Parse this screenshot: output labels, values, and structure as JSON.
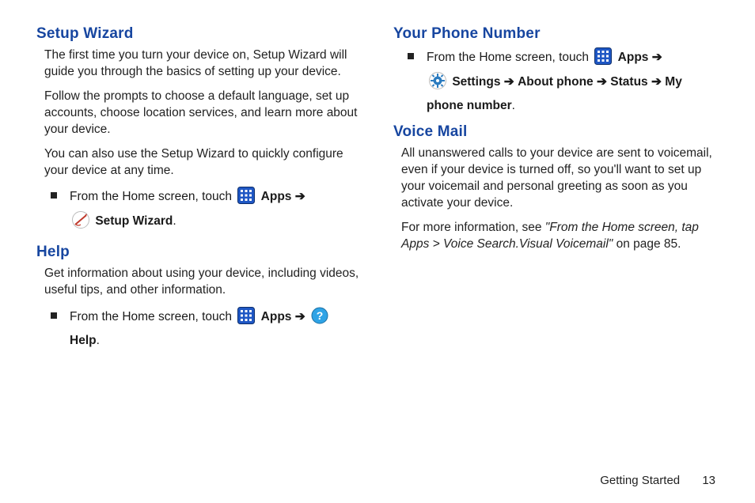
{
  "left": {
    "setup_wizard": {
      "heading": "Setup Wizard",
      "p1": "The first time you turn your device on, Setup Wizard will guide you through the basics of setting up your device.",
      "p2": "Follow the prompts to choose a default language, set up accounts, choose location services, and learn more about your device.",
      "p3": "You can also use the Setup Wizard to quickly configure your device at any time.",
      "step_prefix": "From the Home screen, touch ",
      "apps_label": "Apps",
      "arrow": "➔",
      "setup_wizard_label": "Setup Wizard"
    },
    "help": {
      "heading": "Help",
      "p1": "Get information about using your device, including videos, useful tips, and other information.",
      "step_prefix": "From the Home screen, touch ",
      "apps_label": "Apps",
      "arrow": "➔",
      "help_label": "Help"
    }
  },
  "right": {
    "phone_number": {
      "heading": "Your Phone Number",
      "step_prefix": "From the Home screen, touch ",
      "apps_label": "Apps",
      "arrow": "➔",
      "settings_label": "Settings",
      "about_label": "About phone",
      "status_label": "Status",
      "my_number_label": "My phone number"
    },
    "voice_mail": {
      "heading": "Voice Mail",
      "p1": "All unanswered calls to your device are sent to voicemail, even if your device is turned off, so you'll want to set up your voicemail and personal greeting as soon as you activate your device.",
      "p2_prefix": "For more information, see ",
      "p2_ital": "\"From the Home screen, tap Apps >  Voice Search.Visual Voicemail\"",
      "p2_suffix": " on page 85."
    }
  },
  "footer": {
    "chapter": "Getting Started",
    "page": "13"
  }
}
